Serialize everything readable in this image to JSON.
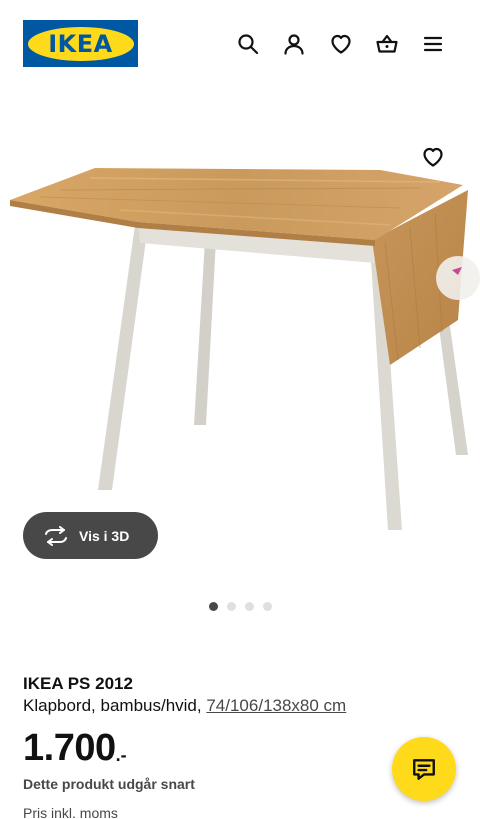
{
  "header": {
    "logo_text": "IKEA",
    "icons": [
      "search-icon",
      "user-icon",
      "heart-icon",
      "basket-icon",
      "menu-icon"
    ]
  },
  "gallery": {
    "favorite_icon": "heart-icon",
    "view_3d_label": "Vis i 3D",
    "view_3d_icon": "rotate-icon",
    "dots_count": 4,
    "active_dot": 0
  },
  "product": {
    "name": "IKEA PS 2012",
    "description": "Klapbord, bambus/hvid, ",
    "dimensions": "74/106/138x80 cm",
    "price_integer": "1.700",
    "price_suffix": ".-",
    "notice": "Dette produkt udgår snart",
    "vat_note": "Pris inkl. moms"
  },
  "chat": {
    "icon": "chat-icon"
  },
  "colors": {
    "brand_blue": "#0058a3",
    "brand_yellow": "#ffda1a",
    "button_dark": "#484848"
  }
}
